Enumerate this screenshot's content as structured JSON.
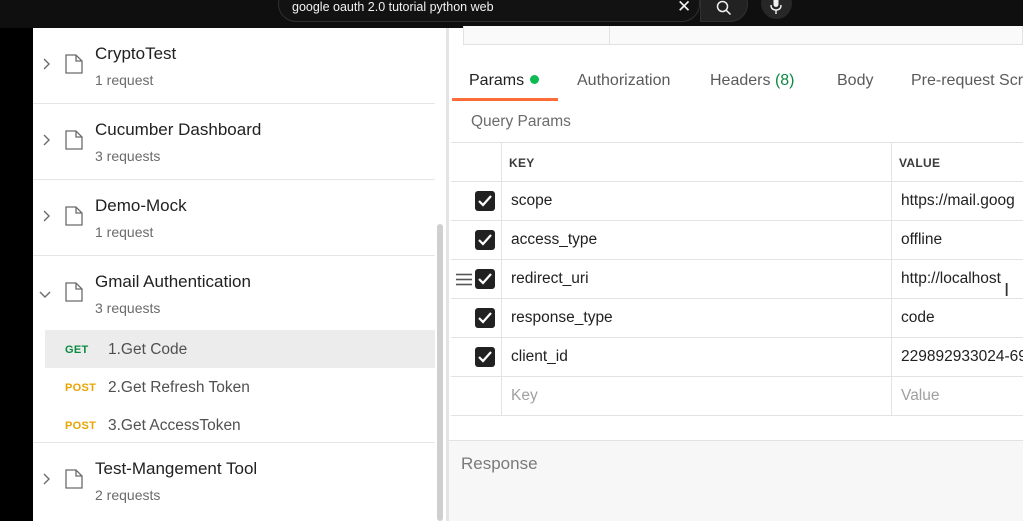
{
  "search": {
    "query": "google oauth 2.0 tutorial python web",
    "clear_icon": "close-icon",
    "search_icon": "search-icon",
    "mic_icon": "microphone-icon"
  },
  "sidebar": {
    "collections": [
      {
        "name": "CryptoTest",
        "count": "1 request",
        "expanded": false
      },
      {
        "name": "Cucumber Dashboard",
        "count": "3 requests",
        "expanded": false
      },
      {
        "name": "Demo-Mock",
        "count": "1 request",
        "expanded": false
      },
      {
        "name": "Gmail Authentication",
        "count": "3 requests",
        "expanded": true
      },
      {
        "name": "Test-Mangement Tool",
        "count": "2 requests",
        "expanded": false
      }
    ],
    "requests": [
      {
        "method": "GET",
        "name": "1.Get Code",
        "selected": true
      },
      {
        "method": "POST",
        "name": "2.Get Refresh Token",
        "selected": false
      },
      {
        "method": "POST",
        "name": "3.Get AccessToken",
        "selected": false
      }
    ]
  },
  "tabs": {
    "params": "Params",
    "authorization": "Authorization",
    "headers": "Headers",
    "headers_count": "(8)",
    "body": "Body",
    "prerequest": "Pre-request Scri"
  },
  "query_params": {
    "title": "Query Params",
    "col_key": "KEY",
    "col_value": "VALUE",
    "rows": [
      {
        "key": "scope",
        "value": "https://mail.goog",
        "checked": true
      },
      {
        "key": "access_type",
        "value": "offline",
        "checked": true
      },
      {
        "key": "redirect_uri",
        "value": "http://localhost",
        "checked": true
      },
      {
        "key": "response_type",
        "value": "code",
        "checked": true
      },
      {
        "key": "client_id",
        "value": "229892933024-69",
        "checked": true
      }
    ],
    "key_placeholder": "Key",
    "value_placeholder": "Value"
  },
  "response": {
    "label": "Response"
  },
  "colors": {
    "accent": "#ff6c37",
    "get": "#0c8a43",
    "post": "#e9a400",
    "dot": "#0cbb52"
  }
}
